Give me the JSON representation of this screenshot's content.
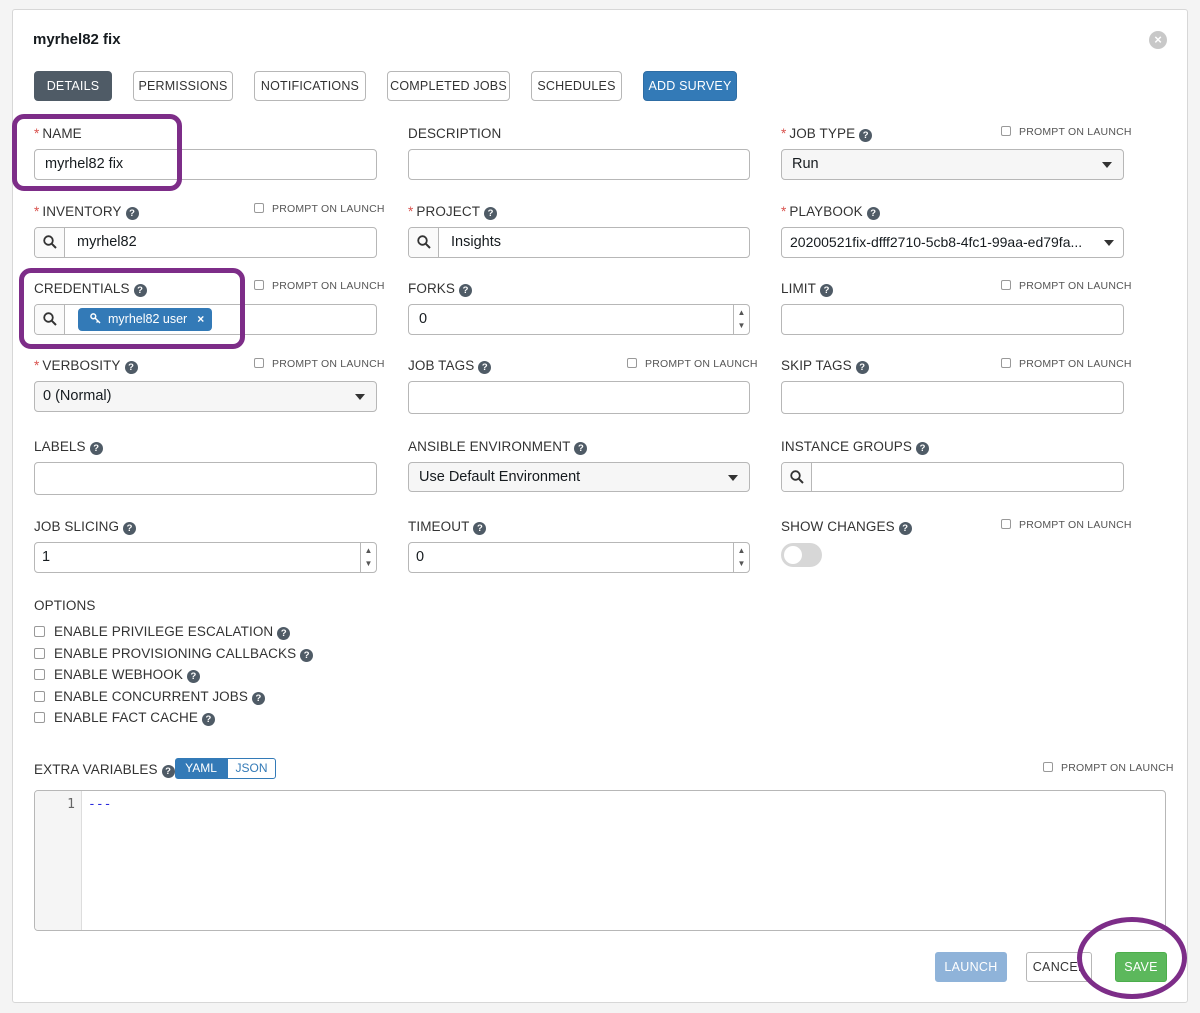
{
  "modal": {
    "title": "myrhel82 fix",
    "close_icon": "close-icon"
  },
  "tabs": [
    {
      "label": "DETAILS",
      "active": true
    },
    {
      "label": "PERMISSIONS"
    },
    {
      "label": "NOTIFICATIONS"
    },
    {
      "label": "COMPLETED JOBS"
    },
    {
      "label": "SCHEDULES"
    },
    {
      "label": "ADD SURVEY"
    }
  ],
  "prompt_on_launch": "PROMPT ON LAUNCH",
  "fields": {
    "name": {
      "label": "NAME",
      "value": "myrhel82 fix"
    },
    "description": {
      "label": "DESCRIPTION",
      "value": ""
    },
    "job_type": {
      "label": "JOB TYPE",
      "value": "Run"
    },
    "inventory": {
      "label": "INVENTORY",
      "value": "myrhel82"
    },
    "project": {
      "label": "PROJECT",
      "value": "Insights"
    },
    "playbook": {
      "label": "PLAYBOOK",
      "value": "20200521fix-dfff2710-5cb8-4fc1-99aa-ed79fa..."
    },
    "credentials": {
      "label": "CREDENTIALS",
      "tag": "myrhel82 user"
    },
    "forks": {
      "label": "FORKS",
      "value": "0"
    },
    "limit": {
      "label": "LIMIT",
      "value": ""
    },
    "verbosity": {
      "label": "VERBOSITY",
      "value": "0 (Normal)"
    },
    "job_tags": {
      "label": "JOB TAGS",
      "value": ""
    },
    "skip_tags": {
      "label": "SKIP TAGS",
      "value": ""
    },
    "labels": {
      "label": "LABELS",
      "value": ""
    },
    "ansible_environment": {
      "label": "ANSIBLE ENVIRONMENT",
      "value": "Use Default Environment"
    },
    "instance_groups": {
      "label": "INSTANCE GROUPS",
      "value": ""
    },
    "job_slicing": {
      "label": "JOB SLICING",
      "value": "1"
    },
    "timeout": {
      "label": "TIMEOUT",
      "value": "0"
    },
    "show_changes": {
      "label": "SHOW CHANGES",
      "on": false
    }
  },
  "options": {
    "label": "OPTIONS",
    "items": [
      "ENABLE PRIVILEGE ESCALATION",
      "ENABLE PROVISIONING CALLBACKS",
      "ENABLE WEBHOOK",
      "ENABLE CONCURRENT JOBS",
      "ENABLE FACT CACHE"
    ]
  },
  "extra_variables": {
    "label": "EXTRA VARIABLES",
    "modes": [
      "YAML",
      "JSON"
    ],
    "line_number": "1",
    "code": "---"
  },
  "actions": {
    "launch": "LAUNCH",
    "cancel": "CANCEL",
    "save": "SAVE"
  },
  "colors": {
    "primary": "#337ab7",
    "active_tab": "#4f5b66",
    "save": "#5cb85c",
    "required": "#d9534f",
    "highlight": "#7d2d88"
  }
}
